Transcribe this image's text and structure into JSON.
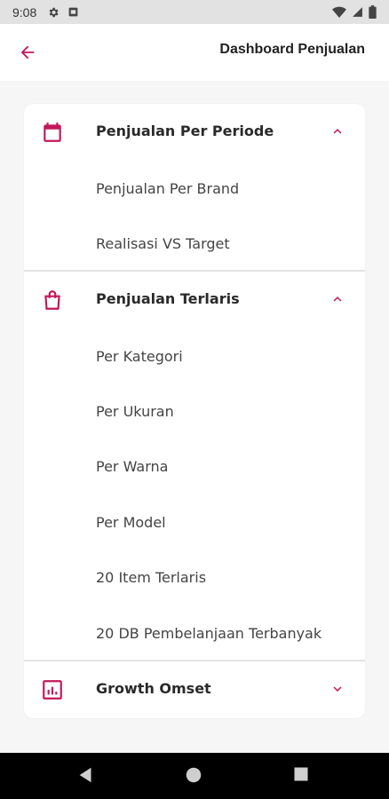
{
  "statusbar": {
    "time": "9:08",
    "icons": [
      "settings-icon",
      "notification-icon",
      "wifi-icon",
      "signal-icon",
      "battery-icon"
    ]
  },
  "appbar": {
    "title": "Dashboard Penjualan",
    "back_icon": "arrow-left-icon"
  },
  "theme": {
    "accent": "#c2185b",
    "text": "#2a2a2a",
    "subtext": "#444444"
  },
  "menu": {
    "sections": [
      {
        "icon": "calendar-icon",
        "label": "Penjualan Per Periode",
        "expanded": true,
        "items": [
          "Penjualan Per Brand",
          "Realisasi VS Target"
        ]
      },
      {
        "icon": "shopping-bag-icon",
        "label": "Penjualan Terlaris",
        "expanded": true,
        "items": [
          "Per Kategori",
          "Per Ukuran",
          "Per Warna",
          "Per Model",
          "20 Item Terlaris",
          "20 DB Pembelanjaan Terbanyak"
        ]
      },
      {
        "icon": "chart-report-icon",
        "label": "Growth Omset",
        "expanded": false,
        "items": []
      }
    ]
  },
  "navbar": {
    "icons": [
      "back-triangle-icon",
      "home-circle-icon",
      "recents-square-icon"
    ]
  }
}
